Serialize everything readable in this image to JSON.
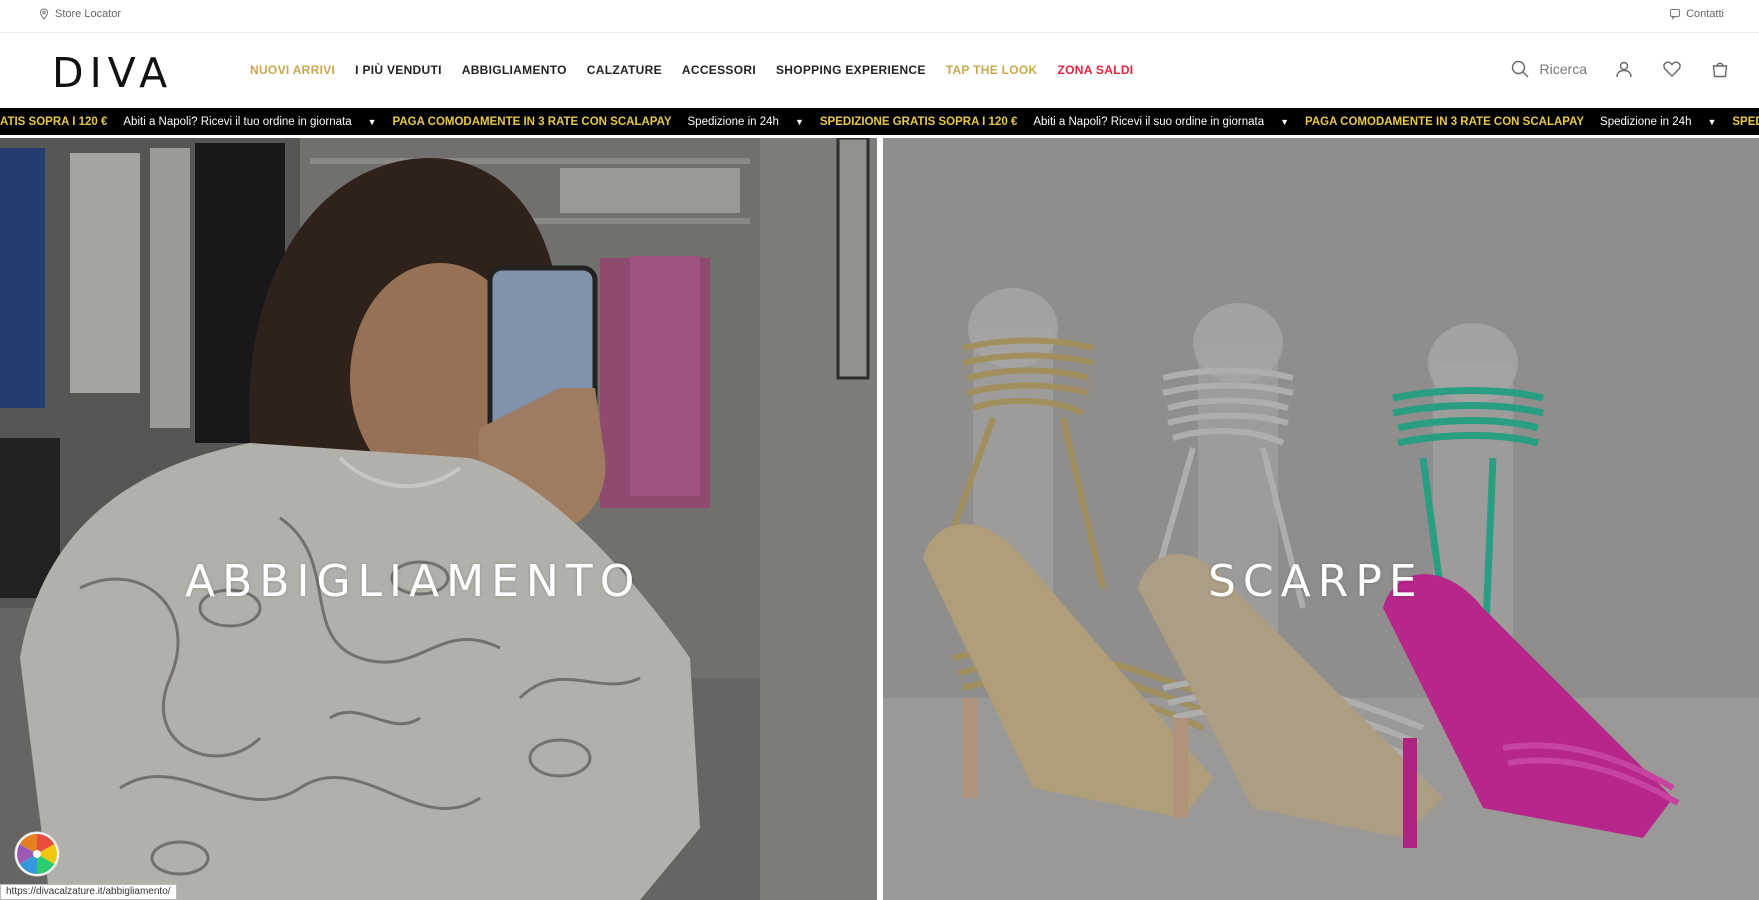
{
  "util": {
    "store_locator": "Store Locator",
    "contacts": "Contatti"
  },
  "brand": {
    "logo": "DIVA"
  },
  "nav": {
    "items": [
      {
        "label": "NUOVI ARRIVI",
        "color": "#c9a74b"
      },
      {
        "label": "I PIÙ VENDUTI",
        "color": "#222222"
      },
      {
        "label": "ABBIGLIAMENTO",
        "color": "#222222"
      },
      {
        "label": "CALZATURE",
        "color": "#222222"
      },
      {
        "label": "ACCESSORI",
        "color": "#222222"
      },
      {
        "label": "SHOPPING EXPERIENCE",
        "color": "#222222"
      },
      {
        "label": "TAP THE LOOK",
        "color": "#c9a74b"
      },
      {
        "label": "ZONA SALDI",
        "color": "#e0243d"
      }
    ]
  },
  "header": {
    "search_label": "Ricerca",
    "icons": [
      "search-icon",
      "user-icon",
      "heart-icon",
      "bag-icon"
    ]
  },
  "marquee": {
    "items": [
      {
        "text": "ATIS SOPRA I 120 €",
        "style": "gold"
      },
      {
        "text": "Abiti a Napoli? Ricevi il tuo ordine in giornata",
        "style": "white"
      },
      {
        "text": "PAGA COMODAMENTE IN 3 RATE CON SCALAPAY",
        "style": "gold"
      },
      {
        "text": "Spedizione in 24h",
        "style": "white"
      },
      {
        "text": "SPEDIZIONE GRATIS SOPRA I 120 €",
        "style": "gold"
      },
      {
        "text": "Abiti a Napoli? Ricevi il suo ordine in giornata",
        "style": "white"
      },
      {
        "text": "PAGA COMODAMENTE IN 3 RATE CON SCALAPAY",
        "style": "gold"
      },
      {
        "text": "Spedizione in 24h",
        "style": "white"
      },
      {
        "text": "SPEDI",
        "style": "gold"
      }
    ]
  },
  "hero": {
    "left_title": "ABBIGLIAMENTO",
    "right_title": "SCARPE"
  },
  "status_url": "https://divacalzature.it/abbigliamento/",
  "colors": {
    "gold": "#c9a74b",
    "red": "#e0243d",
    "marquee_bg": "#000000"
  }
}
